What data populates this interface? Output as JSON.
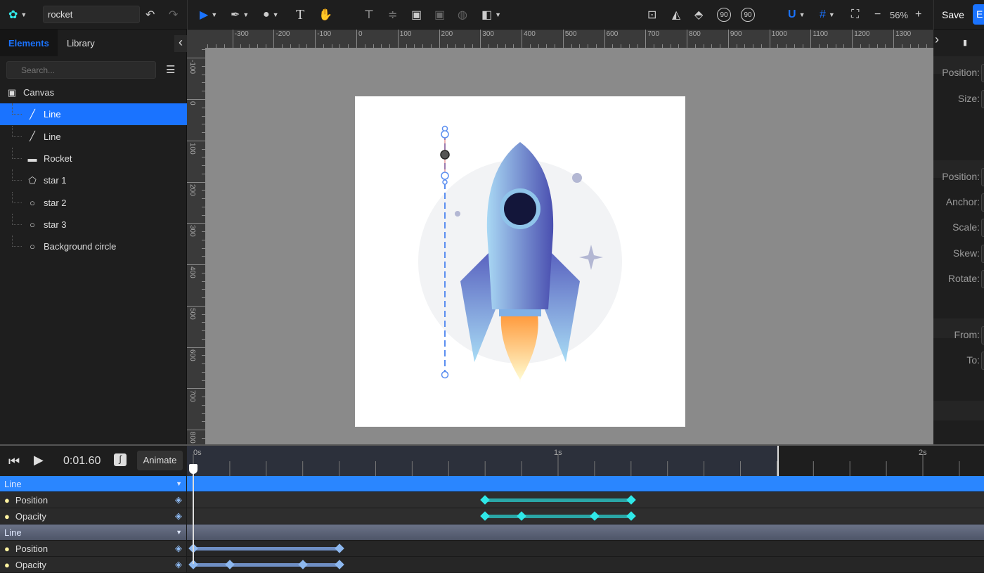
{
  "topbar": {
    "document_name": "rocket",
    "zoom": "56%",
    "save_label": "Save",
    "export_label": "E",
    "tools": [
      "select",
      "pen",
      "shapes",
      "text",
      "hand"
    ],
    "icons": [
      "undo-icon",
      "redo-icon",
      "align-top-icon",
      "align-middle-icon",
      "group-icon",
      "ungroup-icon",
      "mask-icon",
      "arrange-icon",
      "fit-icon",
      "flip-horizontal-icon",
      "flip-vertical-icon",
      "rotate-left-90-icon",
      "rotate-right-90-icon",
      "magnet-icon",
      "grid-icon",
      "fullscreen-icon"
    ],
    "rotate_left_label": "90",
    "rotate_right_label": "90",
    "zoom_out": "−",
    "zoom_in": "+",
    "accent": "#1a73ff"
  },
  "left_panel": {
    "tabs": [
      {
        "label": "Elements",
        "active": true
      },
      {
        "label": "Library",
        "active": false
      }
    ],
    "search_placeholder": "Search...",
    "tree": [
      {
        "label": "Canvas",
        "icon": "canvas-icon",
        "depth": 0
      },
      {
        "label": "Line",
        "icon": "line-icon",
        "depth": 1,
        "selected": true
      },
      {
        "label": "Line",
        "icon": "line-icon",
        "depth": 1
      },
      {
        "label": "Rocket",
        "icon": "folder-icon",
        "depth": 1
      },
      {
        "label": "star 1",
        "icon": "pentagon-icon",
        "depth": 1
      },
      {
        "label": "star 2",
        "icon": "circle-icon",
        "depth": 1
      },
      {
        "label": "star 3",
        "icon": "circle-icon",
        "depth": 1
      },
      {
        "label": "Background circle",
        "icon": "circle-icon",
        "depth": 1
      }
    ]
  },
  "rulers": {
    "top": [
      "-300",
      "-200",
      "-100",
      "0",
      "100",
      "200",
      "300",
      "400",
      "500",
      "600",
      "700",
      "800",
      "900",
      "1000",
      "1100",
      "1200",
      "1300"
    ],
    "left": [
      "-100",
      "0",
      "100",
      "200",
      "300",
      "400",
      "500",
      "600",
      "700",
      "800"
    ]
  },
  "right_panel": {
    "labels": [
      "Position:",
      "Size:",
      "Position:",
      "Anchor:",
      "Scale:",
      "Skew:",
      "Rotate:",
      "From:",
      "To:"
    ]
  },
  "timeline": {
    "time": "0:01.60",
    "animate_label": "Animate",
    "ticks": [
      "0s",
      "1s",
      "2s"
    ],
    "end_time_s": 1.6,
    "tracks": [
      {
        "name": "Line",
        "selected": true,
        "props": [
          {
            "name": "Position",
            "keys": [
              0.8,
              1.2
            ]
          },
          {
            "name": "Opacity",
            "keys": [
              0.8,
              0.9,
              1.1,
              1.2
            ]
          }
        ]
      },
      {
        "name": "Line",
        "selected": false,
        "props": [
          {
            "name": "Position",
            "keys": [
              0,
              0.4
            ]
          },
          {
            "name": "Opacity",
            "keys": [
              0,
              0.1,
              0.3,
              0.4
            ]
          }
        ]
      }
    ]
  }
}
